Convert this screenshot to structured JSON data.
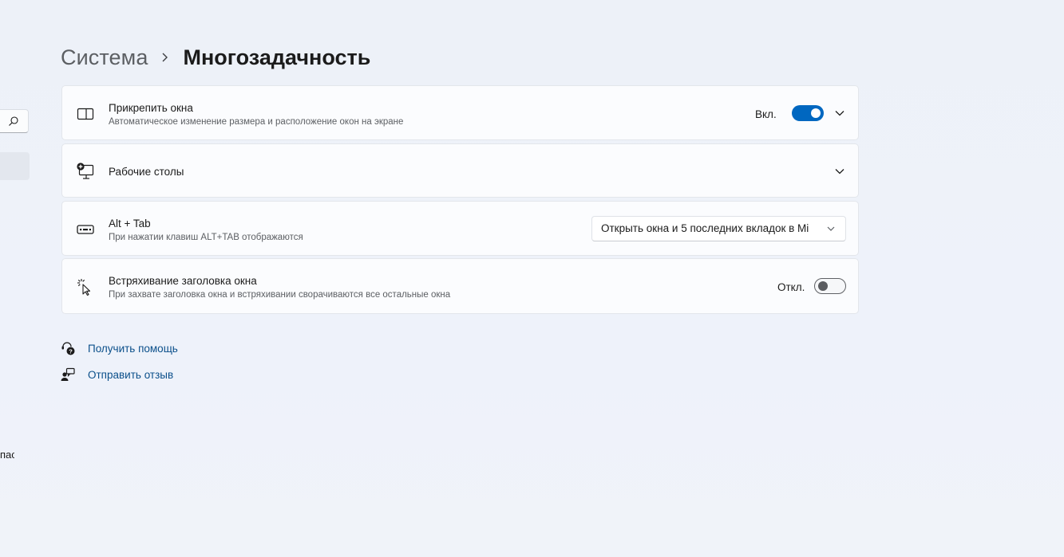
{
  "breadcrumb": {
    "parent": "Система",
    "current": "Многозадачность"
  },
  "nav": {
    "cut_text": "пас"
  },
  "snap": {
    "title": "Прикрепить окна",
    "desc": "Автоматическое изменение размера и расположение окон на экране",
    "state": "Вкл.",
    "enabled": true
  },
  "desktops": {
    "title": "Рабочие столы"
  },
  "alttab": {
    "title": "Alt + Tab",
    "desc": "При нажатии клавиш ALT+TAB отображаются",
    "selected": "Открыть окна и 5 последних вкладок в Mi"
  },
  "shake": {
    "title": "Встряхивание заголовка окна",
    "desc": "При захвате заголовка окна и встряхивании сворачиваются все остальные окна",
    "state": "Откл.",
    "enabled": false
  },
  "links": {
    "help": "Получить помощь",
    "feedback": "Отправить отзыв"
  },
  "colors": {
    "accent": "#0067c0",
    "link": "#0a4f8a",
    "background": "#eef2f9",
    "card": "#fbfcfe"
  }
}
